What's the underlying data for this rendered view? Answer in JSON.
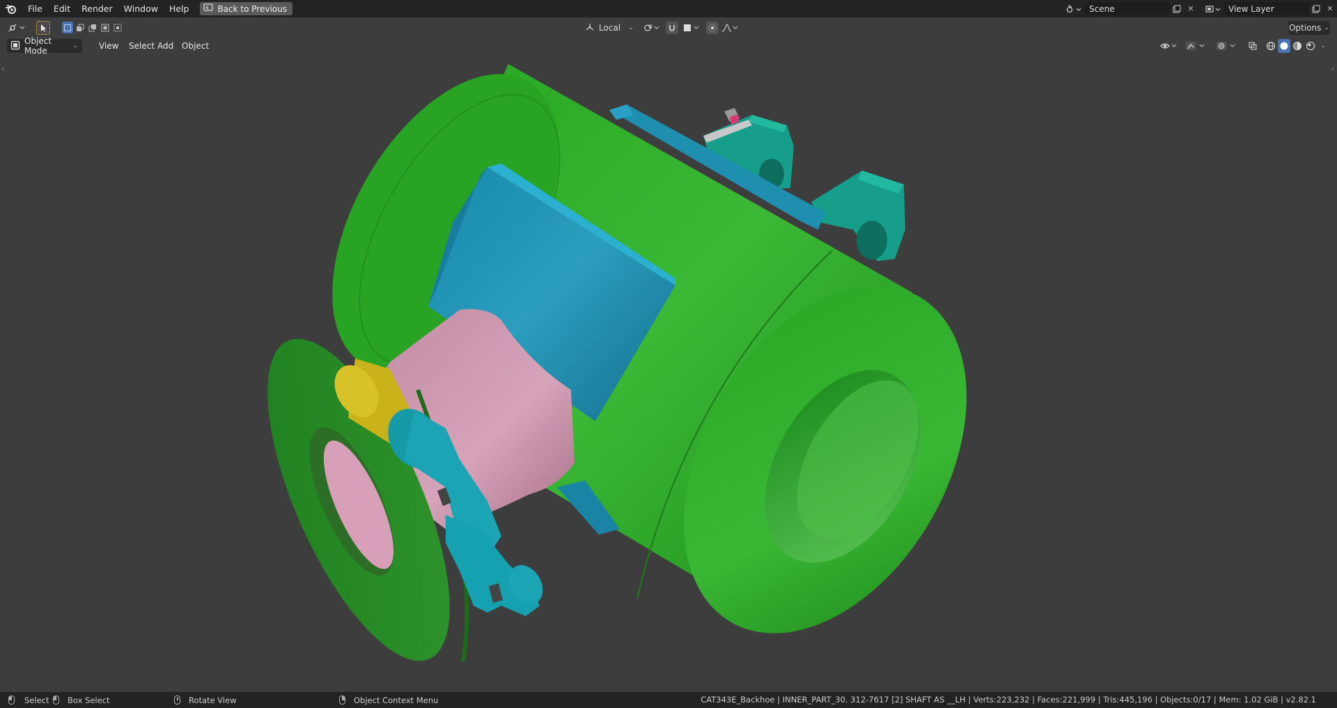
{
  "menu": {
    "items": [
      "File",
      "Edit",
      "Render",
      "Window",
      "Help"
    ],
    "back_label": "Back to Previous"
  },
  "top_right": {
    "scene_value": "Scene",
    "view_layer_value": "View Layer"
  },
  "tool_header": {
    "transform_orientation": "Local",
    "options_label": "Options"
  },
  "view_header": {
    "mode": "Object Mode",
    "menus": [
      "View",
      "Select",
      "Add",
      "Object"
    ]
  },
  "status": {
    "select": "Select",
    "box_select": "Box Select",
    "rotate_view": "Rotate View",
    "context_menu": "Object Context Menu",
    "info": "CAT343E_Backhoe | INNER_PART_30. 312-7617 [2] SHAFT AS __LH | Verts:223,232 | Faces:221,999 | Tris:445,196 | Objects:0/17 | Mem: 1.02 GiB | v2.82.1"
  },
  "colors": {
    "green": "#2fa82a",
    "blue": "#1f8fb0",
    "teal": "#179e8a",
    "pink": "#c98ea8",
    "yellow": "#c9b21a",
    "background": "#3d3d3d"
  }
}
